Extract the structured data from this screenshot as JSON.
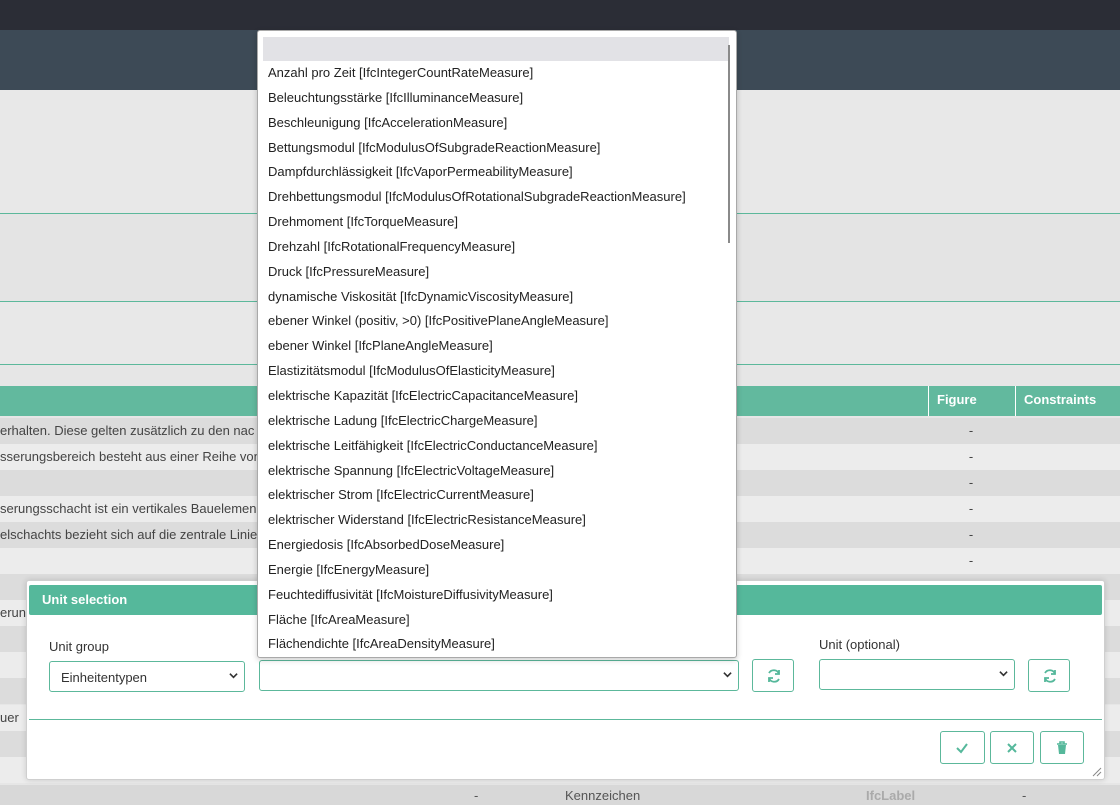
{
  "table": {
    "headers": {
      "figure": "Figure",
      "constraints": "Constraints"
    },
    "rows": [
      {
        "desc": "erhalten. Diese gelten zusätzlich zu den nac",
        "figure": "-"
      },
      {
        "desc": "sserungsbereich besteht aus einer Reihe von",
        "figure": "-"
      },
      {
        "desc": "",
        "figure": "-"
      },
      {
        "desc": "serungsschacht ist ein vertikales Bauelemen",
        "figure": "-"
      },
      {
        "desc": "elschachts bezieht sich auf die zentrale Linie",
        "figure": "-"
      },
      {
        "desc": "",
        "figure": "-"
      }
    ],
    "partial_rows": [
      {
        "desc": "erung"
      },
      {
        "desc": "uer"
      }
    ],
    "bottom_row": {
      "dash": "-",
      "name": "Kennzeichen",
      "type": "IfcLabel",
      "constraint": "-"
    }
  },
  "modal": {
    "title": "Unit selection",
    "unit_group_label": "Unit group",
    "unit_group_value": "Einheitentypen",
    "unit_type_value": "",
    "unit_label": "Unit (optional)",
    "unit_value": ""
  },
  "dropdown": {
    "options": [
      "Anzahl pro Zeit [IfcIntegerCountRateMeasure]",
      "Beleuchtungsstärke [IfcIlluminanceMeasure]",
      "Beschleunigung [IfcAccelerationMeasure]",
      "Bettungsmodul [IfcModulusOfSubgradeReactionMeasure]",
      "Dampfdurchlässigkeit [IfcVaporPermeabilityMeasure]",
      "Drehbettungsmodul [IfcModulusOfRotationalSubgradeReactionMeasure]",
      "Drehmoment [IfcTorqueMeasure]",
      "Drehzahl [IfcRotationalFrequencyMeasure]",
      "Druck [IfcPressureMeasure]",
      "dynamische Viskosität [IfcDynamicViscosityMeasure]",
      "ebener Winkel (positiv, >0) [IfcPositivePlaneAngleMeasure]",
      "ebener Winkel [IfcPlaneAngleMeasure]",
      "Elastizitätsmodul [IfcModulusOfElasticityMeasure]",
      "elektrische Kapazität [IfcElectricCapacitanceMeasure]",
      "elektrische Ladung [IfcElectricChargeMeasure]",
      "elektrische Leitfähigkeit [IfcElectricConductanceMeasure]",
      "elektrische Spannung [IfcElectricVoltageMeasure]",
      "elektrischer Strom [IfcElectricCurrentMeasure]",
      "elektrischer Widerstand [IfcElectricResistanceMeasure]",
      "Energiedosis [IfcAbsorbedDoseMeasure]",
      "Energie [IfcEnergyMeasure]",
      "Feuchtediffusivität [IfcMoistureDiffusivityMeasure]",
      "Fläche [IfcAreaMeasure]",
      "Flächendichte [IfcAreaDensityMeasure]"
    ]
  },
  "colors": {
    "accent": "#55b89b",
    "header": "#3d4a56",
    "topbar": "#2b2d36"
  },
  "icons": [
    "chevron-down-icon",
    "refresh-icon",
    "check-icon",
    "close-icon",
    "trash-icon",
    "resize-grip-icon"
  ]
}
